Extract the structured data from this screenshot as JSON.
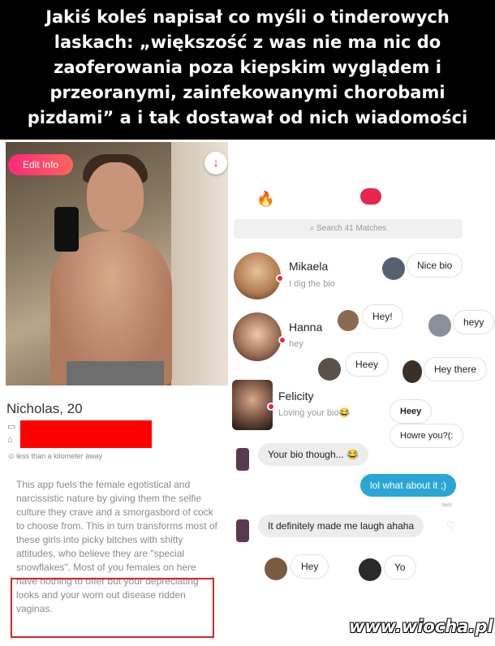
{
  "caption": "Jakiś koleś napisał co myśli o tinderowych laskach: „większość z was nie ma nic do zaoferowania poza kiepskim wyglądem i przeoranymi, zainfekowanymi chorobami pizdami” a i tak dostawał od nich wiadomości",
  "profile": {
    "edit_label": "Edit Info",
    "name_age": "Nicholas, 20",
    "distance": "less than a kilometer away",
    "bio": "This app fuels the female egotistical and narcissistic nature by giving them the selfie culture they crave and a smorgasbord of cock to choose from. This in turn transforms most of these girls into picky bitches with shitty attitudes, who believe they are \"special snowflakes\". Most of you females on here have nothing to offer but your depreciating looks and your worn out disease ridden vaginas.",
    "accent": "#fd297b",
    "highlight_color": "#d8232a"
  },
  "messages": {
    "search_placeholder": "Search 41 Matches",
    "matches": [
      {
        "name": "Mikaela",
        "preview": "I dig the bio"
      },
      {
        "name": "Hanna",
        "preview": "hey"
      },
      {
        "name": "Felicity",
        "preview": "Loving your bio😂"
      }
    ],
    "bubbles": {
      "nice_bio": "Nice bio",
      "hey_excl": "Hey!",
      "heyy": "heyy",
      "heey": "Heey",
      "hey_there": "Hey there",
      "heey2": "Heey",
      "howre": "Howre you?(:",
      "bio_though": "Your bio though... 😂",
      "lol": "lol what about it ;)",
      "sent": "Sent",
      "laugh": "It definitely made me laugh ahaha",
      "hey": "Hey",
      "yo": "Yo"
    }
  },
  "watermark": "www.wiocha.pl"
}
